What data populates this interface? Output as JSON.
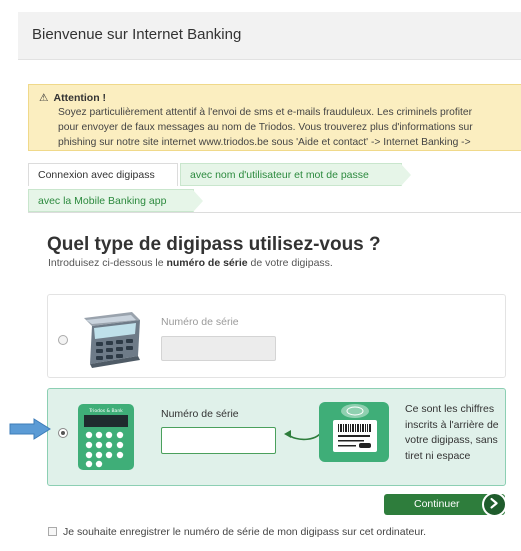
{
  "header": {
    "title": "Bienvenue sur Internet Banking"
  },
  "alert": {
    "icon": "warning-icon",
    "title": "Attention !",
    "lines": [
      "Soyez particulièrement attentif à l'envoi de sms et e-mails frauduleux. Les criminels profiter",
      "pour envoyer de faux messages au nom de Triodos. Vous trouverez plus d'informations sur",
      "phishing sur notre site internet www.triodos.be sous 'Aide et contact' -> Internet Banking ->"
    ]
  },
  "tabs": [
    {
      "label": "Connexion avec digipass",
      "active": true
    },
    {
      "label": "avec nom d'utilisateur et mot de passe",
      "active": false
    },
    {
      "label": "avec la Mobile Banking app",
      "active": false
    }
  ],
  "main": {
    "title": "Quel type de digipass utilisez-vous ?",
    "subtitle_before": "Introduisez ci-dessous le ",
    "subtitle_bold": "numéro de série",
    "subtitle_after": " de votre digipass."
  },
  "options": [
    {
      "label": "Numéro de série",
      "value": "",
      "selected": false,
      "icon": "grey-digipass-icon"
    },
    {
      "label": "Numéro de série",
      "value": "",
      "selected": true,
      "icon": "green-digipass-icon",
      "device_brand": "Triodos & Bank",
      "hint": "Ce sont les chiffres inscrits à l'arrière de votre digipass, sans tiret ni espace"
    }
  ],
  "actions": {
    "continue_label": "Continuer"
  },
  "save_option": {
    "label": "Je souhaite enregistrer le numéro de série de mon digipass sur cet ordinateur.",
    "checked": false
  },
  "colors": {
    "brand_green": "#2e7d3c",
    "tab_green": "#2c8a3e",
    "selected_bg": "#e0f1ea",
    "alert_bg": "#fbeec0",
    "pointer": "#5b9bd5"
  }
}
